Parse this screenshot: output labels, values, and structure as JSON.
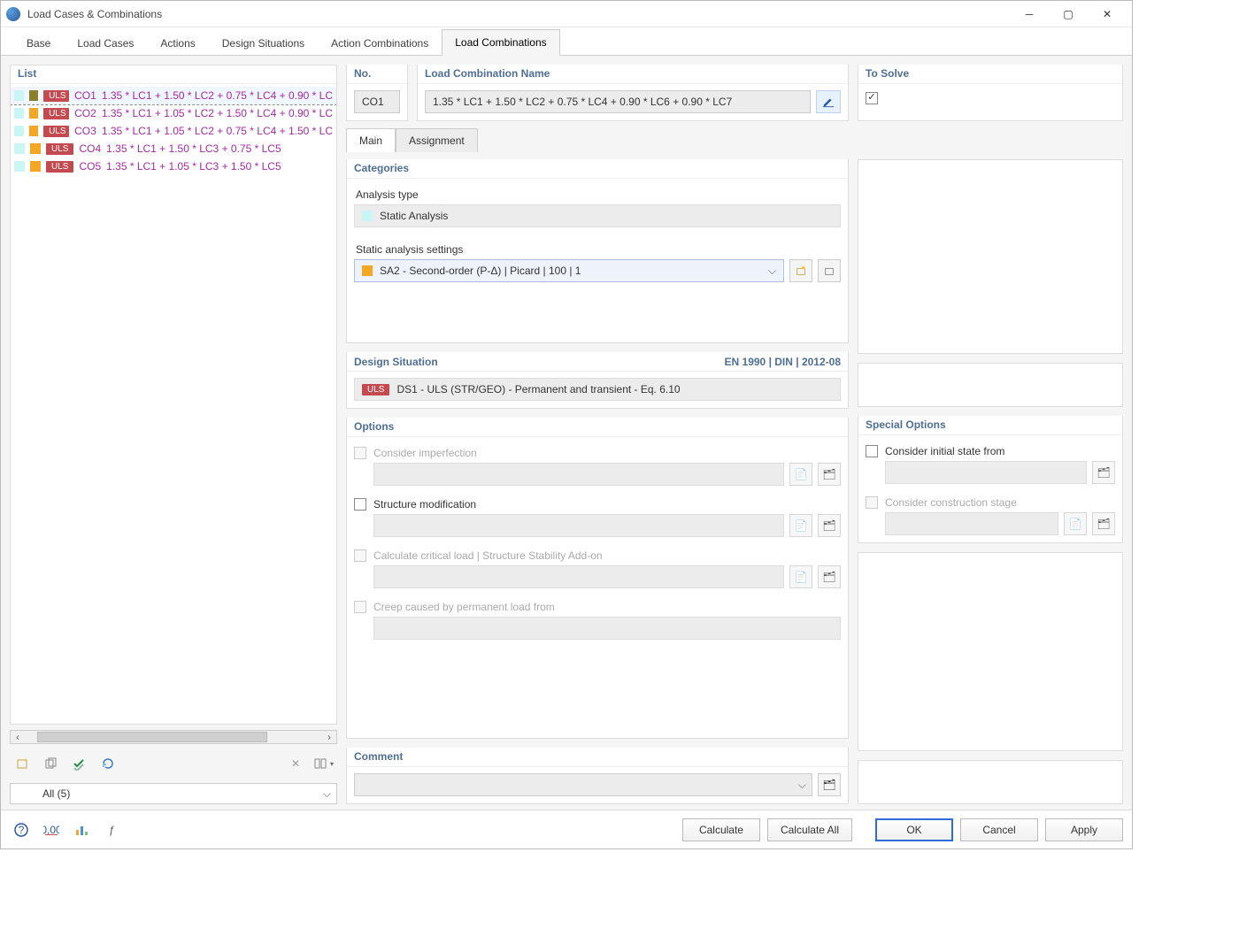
{
  "window": {
    "title": "Load Cases & Combinations"
  },
  "tabs": [
    "Base",
    "Load Cases",
    "Actions",
    "Design Situations",
    "Action Combinations",
    "Load Combinations"
  ],
  "activeTab": 5,
  "list": {
    "title": "List",
    "items": [
      {
        "selected": true,
        "sw1": "cyan",
        "sw2": "olive",
        "badge": "ULS",
        "co": "CO1",
        "expr": "1.35 * LC1 + 1.50 * LC2 + 0.75 * LC4 + 0.90 * LC"
      },
      {
        "selected": false,
        "sw1": "cyan",
        "sw2": "orange",
        "badge": "ULS",
        "co": "CO2",
        "expr": "1.35 * LC1 + 1.05 * LC2 + 1.50 * LC4 + 0.90 * LC"
      },
      {
        "selected": false,
        "sw1": "cyan",
        "sw2": "orange",
        "badge": "ULS",
        "co": "CO3",
        "expr": "1.35 * LC1 + 1.05 * LC2 + 0.75 * LC4 + 1.50 * LC"
      },
      {
        "selected": false,
        "sw1": "cyan",
        "sw2": "orange",
        "badge": "ULS",
        "co": "CO4",
        "expr": "1.35 * LC1 + 1.50 * LC3 + 0.75 * LC5"
      },
      {
        "selected": false,
        "sw1": "cyan",
        "sw2": "orange",
        "badge": "ULS",
        "co": "CO5",
        "expr": "1.35 * LC1 + 1.05 * LC3 + 1.50 * LC5"
      }
    ],
    "filter": "All (5)"
  },
  "header": {
    "no_label": "No.",
    "no_value": "CO1",
    "name_label": "Load Combination Name",
    "name_value": "1.35 * LC1 + 1.50 * LC2 + 0.75 * LC4 + 0.90 * LC6 + 0.90 * LC7",
    "solve_label": "To Solve",
    "solve_checked": true
  },
  "subtabs": [
    "Main",
    "Assignment"
  ],
  "activeSubtab": 0,
  "categories": {
    "title": "Categories",
    "analysis_type_label": "Analysis type",
    "analysis_type_value": "Static Analysis",
    "settings_label": "Static analysis settings",
    "settings_value": "SA2 - Second-order (P-Δ) | Picard | 100 | 1"
  },
  "design_situation": {
    "title": "Design Situation",
    "code": "EN 1990 | DIN | 2012-08",
    "badge": "ULS",
    "value": "DS1 - ULS (STR/GEO) - Permanent and transient - Eq. 6.10"
  },
  "options": {
    "title": "Options",
    "imperfection": "Consider imperfection",
    "structure_mod": "Structure modification",
    "critical_load": "Calculate critical load | Structure Stability Add-on",
    "creep": "Creep caused by permanent load from"
  },
  "special_options": {
    "title": "Special Options",
    "initial_state": "Consider initial state from",
    "construction_stage": "Consider construction stage"
  },
  "comment": {
    "title": "Comment"
  },
  "buttons": {
    "calculate": "Calculate",
    "calculate_all": "Calculate All",
    "ok": "OK",
    "cancel": "Cancel",
    "apply": "Apply"
  }
}
